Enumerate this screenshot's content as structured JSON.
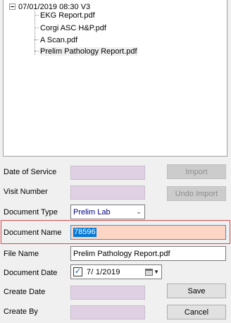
{
  "tree": {
    "root_label": "07/01/2019 08:30 V3",
    "items": [
      {
        "label": "EKG Report.pdf"
      },
      {
        "label": "Corgi ASC  H&P.pdf"
      },
      {
        "label": "A Scan.pdf"
      },
      {
        "label": "Prelim Pathology Report.pdf",
        "selected": true
      }
    ]
  },
  "form": {
    "date_of_service": {
      "label": "Date of Service",
      "value": ""
    },
    "visit_number": {
      "label": "Visit Number",
      "value": ""
    },
    "document_type": {
      "label": "Document Type",
      "value": "Prelim Lab"
    },
    "document_name": {
      "label": "Document Name",
      "value": "78596"
    },
    "file_name": {
      "label": "File Name",
      "value": "Prelim Pathology Report.pdf"
    },
    "document_date": {
      "label": "Document Date",
      "value": "7/  1/2019",
      "checked": true
    },
    "create_date": {
      "label": "Create Date",
      "value": ""
    },
    "create_by": {
      "label": "Create By",
      "value": ""
    }
  },
  "buttons": {
    "import": "Import",
    "undo_import": "Undo Import",
    "save": "Save",
    "cancel": "Cancel"
  },
  "colors": {
    "readonly_field": "#e0d0e4",
    "document_name_bg": "#fcd5c4",
    "highlight_border": "#d54a4a",
    "selection": "#0078d7"
  }
}
